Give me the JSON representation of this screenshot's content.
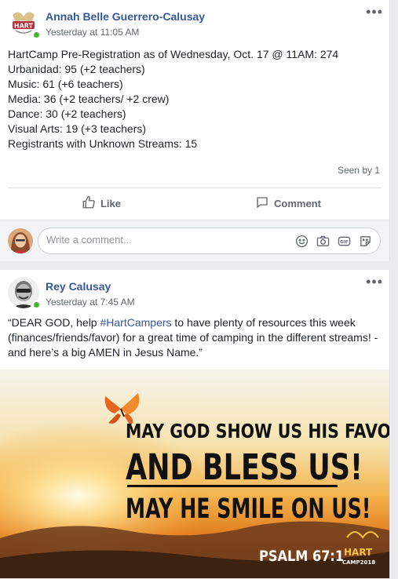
{
  "posts": [
    {
      "author": "Annah Belle Guerrero-Calusay",
      "timestamp": "Yesterday at 11:05 AM",
      "more_label": "•••",
      "lines": [
        "HartCamp Pre-Registration as of Wednesday, Oct. 17 @ 11AM: 274",
        "Urbanidad: 95 (+2 teachers)",
        "Music: 61 (+6 teachers)",
        "Media: 36 (+2 teachers/ +2 crew)",
        "Dance: 30 (+2 teachers)",
        "Visual Arts: 19 (+3 teachers)",
        "Registrants with Unknown Streams: 15"
      ],
      "seen_by": "Seen by 1",
      "like_label": "Like",
      "comment_label": "Comment",
      "comment_placeholder": "Write a comment..."
    },
    {
      "author": "Rey Calusay",
      "timestamp": "Yesterday at 7:45 AM",
      "more_label": "•••",
      "text_before": "“DEAR GOD, help ",
      "hashtag": "#HartCampers",
      "text_after": " to have plenty of resources this week (finances/friends/favor) for a great time of camping in the different streams! - and here’s a big AMEN in Jesus Name.”",
      "image": {
        "line1": "May God show us His favor",
        "line2": "And bless us!",
        "line3": "May He smile on us!",
        "reference": "PSALM 67:1",
        "logo_text": "HART",
        "logo_sub": "CAMP2018"
      }
    }
  ],
  "icons": {
    "like": "thumbs-up-icon",
    "comment": "speech-bubble-icon",
    "emoji": "smiley-icon",
    "camera": "camera-icon",
    "gif": "gif-icon",
    "sticker": "sticker-icon"
  },
  "colors": {
    "link": "#365899",
    "online": "#42b72a",
    "muted": "#606770"
  }
}
